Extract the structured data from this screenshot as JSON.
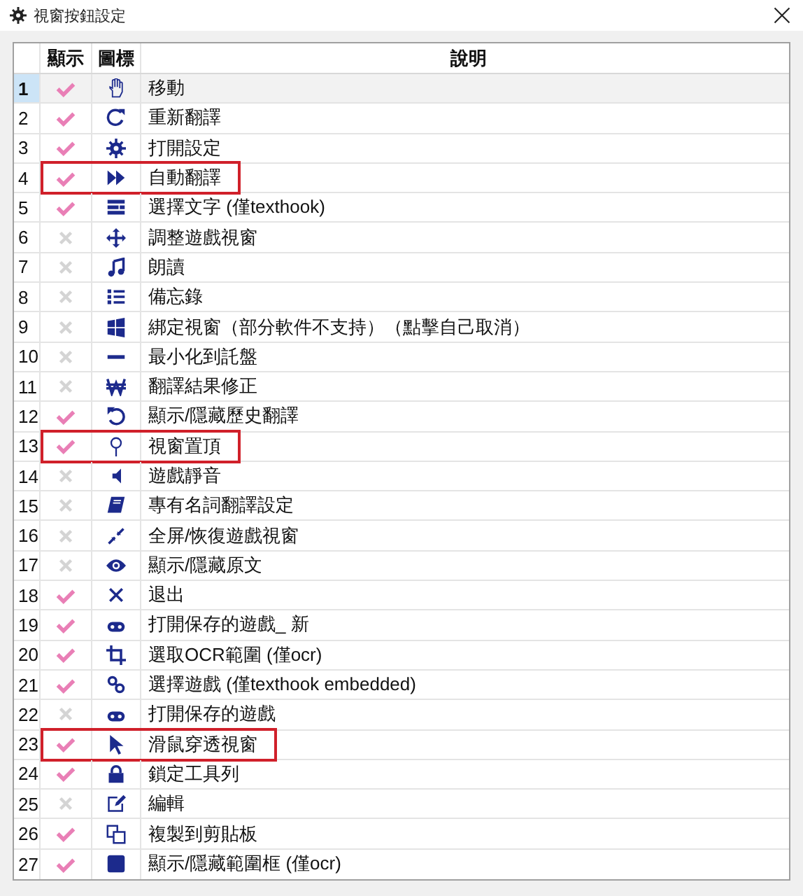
{
  "window": {
    "title": "視窗按鈕設定"
  },
  "table": {
    "columns": [
      "顯示",
      "圖標",
      "說明"
    ],
    "rows": [
      {
        "number": "1",
        "checked": true,
        "selected": true,
        "highlighted": false,
        "description": "移動"
      },
      {
        "number": "2",
        "checked": true,
        "selected": false,
        "highlighted": false,
        "description": "重新翻譯"
      },
      {
        "number": "3",
        "checked": true,
        "selected": false,
        "highlighted": false,
        "description": "打開設定"
      },
      {
        "number": "4",
        "checked": true,
        "selected": false,
        "highlighted": true,
        "description": "自動翻譯"
      },
      {
        "number": "5",
        "checked": true,
        "selected": false,
        "highlighted": false,
        "description": "選擇文字 (僅texthook)"
      },
      {
        "number": "6",
        "checked": false,
        "selected": false,
        "highlighted": false,
        "description": "調整遊戲視窗"
      },
      {
        "number": "7",
        "checked": false,
        "selected": false,
        "highlighted": false,
        "description": "朗讀"
      },
      {
        "number": "8",
        "checked": false,
        "selected": false,
        "highlighted": false,
        "description": "備忘錄"
      },
      {
        "number": "9",
        "checked": false,
        "selected": false,
        "highlighted": false,
        "description": "綁定視窗（部分軟件不支持）（點擊自己取消）"
      },
      {
        "number": "10",
        "checked": false,
        "selected": false,
        "highlighted": false,
        "description": "最小化到託盤"
      },
      {
        "number": "11",
        "checked": false,
        "selected": false,
        "highlighted": false,
        "description": "翻譯結果修正"
      },
      {
        "number": "12",
        "checked": true,
        "selected": false,
        "highlighted": false,
        "description": "顯示/隱藏歷史翻譯"
      },
      {
        "number": "13",
        "checked": true,
        "selected": false,
        "highlighted": true,
        "description": "視窗置頂"
      },
      {
        "number": "14",
        "checked": false,
        "selected": false,
        "highlighted": false,
        "description": "遊戲靜音"
      },
      {
        "number": "15",
        "checked": false,
        "selected": false,
        "highlighted": false,
        "description": "專有名詞翻譯設定"
      },
      {
        "number": "16",
        "checked": false,
        "selected": false,
        "highlighted": false,
        "description": "全屏/恢復遊戲視窗"
      },
      {
        "number": "17",
        "checked": false,
        "selected": false,
        "highlighted": false,
        "description": "顯示/隱藏原文"
      },
      {
        "number": "18",
        "checked": true,
        "selected": false,
        "highlighted": false,
        "description": "退出"
      },
      {
        "number": "19",
        "checked": true,
        "selected": false,
        "highlighted": false,
        "description": "打開保存的遊戲_ 新"
      },
      {
        "number": "20",
        "checked": true,
        "selected": false,
        "highlighted": false,
        "description": "選取OCR範圍 (僅ocr)"
      },
      {
        "number": "21",
        "checked": true,
        "selected": false,
        "highlighted": false,
        "description": "選擇遊戲 (僅texthook embedded)"
      },
      {
        "number": "22",
        "checked": false,
        "selected": false,
        "highlighted": false,
        "description": "打開保存的遊戲"
      },
      {
        "number": "23",
        "checked": true,
        "selected": false,
        "highlighted": true,
        "description": "滑鼠穿透視窗"
      },
      {
        "number": "24",
        "checked": true,
        "selected": false,
        "highlighted": false,
        "description": "鎖定工具列"
      },
      {
        "number": "25",
        "checked": false,
        "selected": false,
        "highlighted": false,
        "description": "編輯"
      },
      {
        "number": "26",
        "checked": true,
        "selected": false,
        "highlighted": false,
        "description": "複製到剪貼板"
      },
      {
        "number": "27",
        "checked": true,
        "selected": false,
        "highlighted": false,
        "description": "顯示/隱藏範圍框 (僅ocr)"
      }
    ]
  }
}
